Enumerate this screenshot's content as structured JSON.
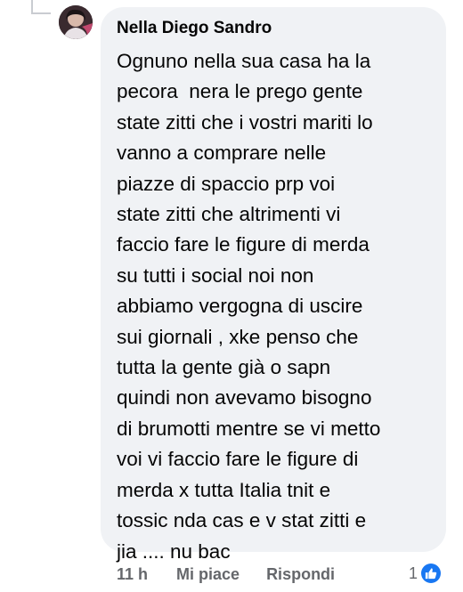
{
  "comment": {
    "author": "Nella Diego Sandro",
    "body_lines": [
      "Ognuno nella sua casa ha la",
      "pecora  nera le prego gente",
      "state zitti che i vostri mariti lo",
      "vanno a comprare nelle",
      "piazze di spaccio prp voi",
      "state zitti che altrimenti vi",
      "faccio fare le figure di merda",
      "su tutti i social noi non",
      "abbiamo vergogna di uscire",
      "sui giornali , xke penso che",
      "tutta la gente già o sapn",
      "quindi non avevamo bisogno",
      "di brumotti mentre se vi metto",
      "voi vi faccio fare le figure di",
      "merda x tutta Italia tnit e",
      "tossic nda cas e v stat zitti e",
      "jia .... nu bac"
    ]
  },
  "actions": {
    "time": "11 h",
    "like_label": "Mi piace",
    "reply_label": "Rispondi"
  },
  "reactions": {
    "count": "1",
    "icon": "thumbs-up-icon",
    "badge_color": "#1877f2"
  }
}
